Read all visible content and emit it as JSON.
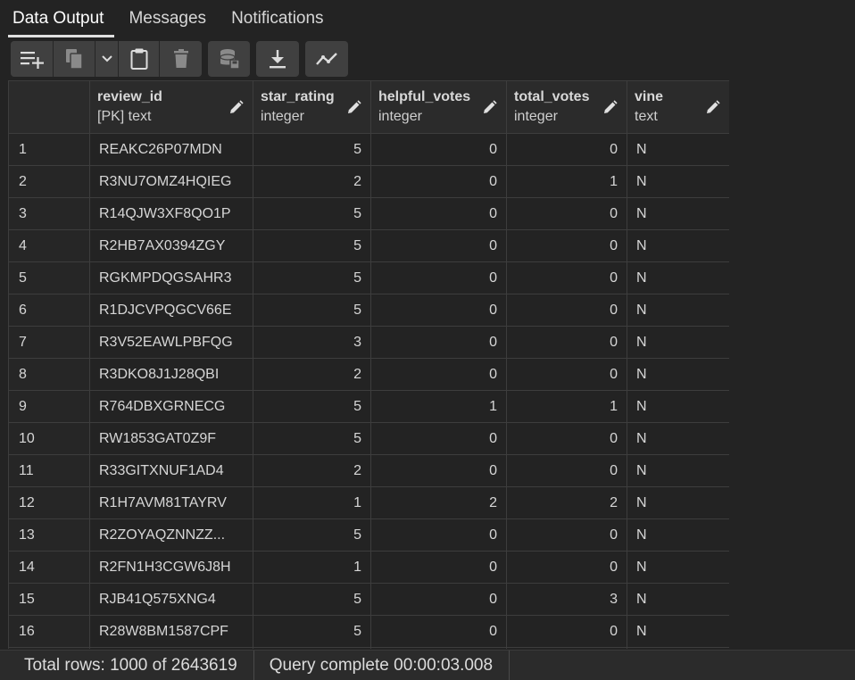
{
  "tabs": [
    {
      "label": "Data Output",
      "active": true
    },
    {
      "label": "Messages",
      "active": false
    },
    {
      "label": "Notifications",
      "active": false
    }
  ],
  "toolbar": {
    "buttons": [
      {
        "icon": "add-row-icon"
      },
      {
        "icon": "copy-icon"
      },
      {
        "icon": "chevron-down-icon"
      },
      {
        "icon": "paste-icon"
      },
      {
        "icon": "delete-icon"
      },
      {
        "icon": "save-data-icon"
      },
      {
        "icon": "download-icon"
      },
      {
        "icon": "graph-visualiser-icon"
      }
    ]
  },
  "columns": [
    {
      "name": "",
      "type": ""
    },
    {
      "name": "review_id",
      "type": "[PK] text"
    },
    {
      "name": "star_rating",
      "type": "integer"
    },
    {
      "name": "helpful_votes",
      "type": "integer"
    },
    {
      "name": "total_votes",
      "type": "integer"
    },
    {
      "name": "vine",
      "type": "text"
    }
  ],
  "rows": [
    [
      "1",
      "REAKC26P07MDN",
      "5",
      "0",
      "0",
      "N"
    ],
    [
      "2",
      "R3NU7OMZ4HQIEG",
      "2",
      "0",
      "1",
      "N"
    ],
    [
      "3",
      "R14QJW3XF8QO1P",
      "5",
      "0",
      "0",
      "N"
    ],
    [
      "4",
      "R2HB7AX0394ZGY",
      "5",
      "0",
      "0",
      "N"
    ],
    [
      "5",
      "RGKMPDQGSAHR3",
      "5",
      "0",
      "0",
      "N"
    ],
    [
      "6",
      "R1DJCVPQGCV66E",
      "5",
      "0",
      "0",
      "N"
    ],
    [
      "7",
      "R3V52EAWLPBFQG",
      "3",
      "0",
      "0",
      "N"
    ],
    [
      "8",
      "R3DKO8J1J28QBI",
      "2",
      "0",
      "0",
      "N"
    ],
    [
      "9",
      "R764DBXGRNECG",
      "5",
      "1",
      "1",
      "N"
    ],
    [
      "10",
      "RW1853GAT0Z9F",
      "5",
      "0",
      "0",
      "N"
    ],
    [
      "11",
      "R33GITXNUF1AD4",
      "2",
      "0",
      "0",
      "N"
    ],
    [
      "12",
      "R1H7AVM81TAYRV",
      "1",
      "2",
      "2",
      "N"
    ],
    [
      "13",
      "R2ZOYAQZNNZZ...",
      "5",
      "0",
      "0",
      "N"
    ],
    [
      "14",
      "R2FN1H3CGW6J8H",
      "1",
      "0",
      "0",
      "N"
    ],
    [
      "15",
      "RJB41Q575XNG4",
      "5",
      "0",
      "3",
      "N"
    ],
    [
      "16",
      "R28W8BM1587CPF",
      "5",
      "0",
      "0",
      "N"
    ],
    [
      "",
      "",
      "",
      "",
      "",
      ""
    ]
  ],
  "status": {
    "total_rows": "Total rows: 1000 of 2643619",
    "query": "Query complete 00:00:03.008"
  },
  "colors": {
    "background": "#232323",
    "header": "#2b2b2b",
    "border": "#3d3d3d",
    "toolbar_button": "#404040"
  }
}
